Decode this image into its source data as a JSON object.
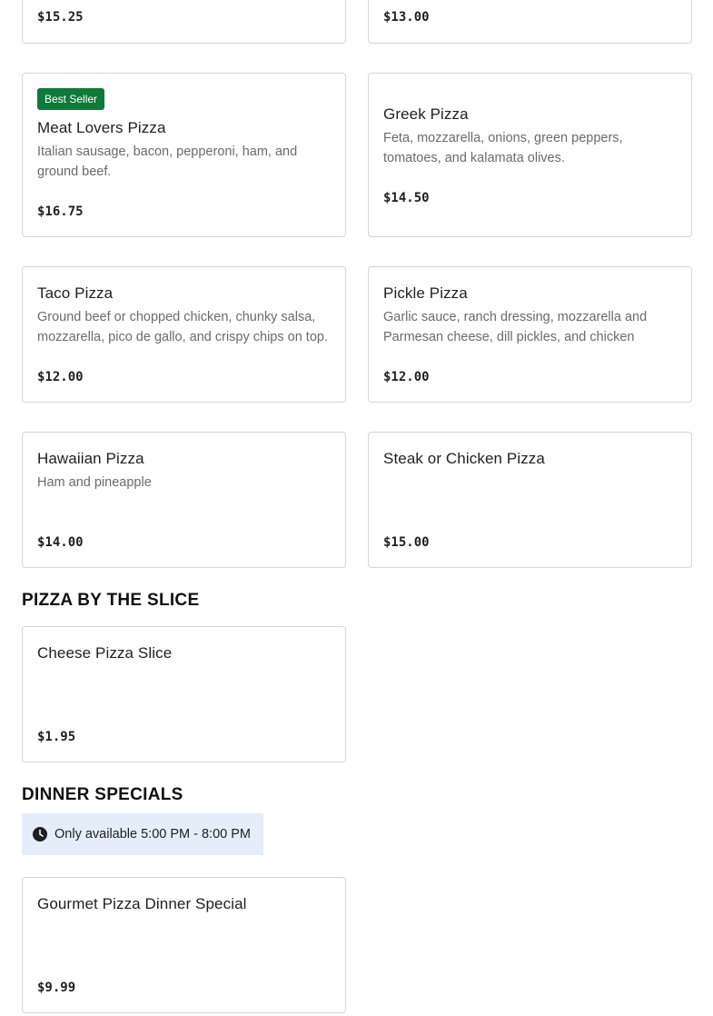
{
  "top_cards": [
    {
      "price": "$15.25"
    },
    {
      "price": "$13.00"
    }
  ],
  "pizzas": [
    {
      "badge": "Best Seller",
      "name": "Meat Lovers Pizza",
      "description": "Italian sausage, bacon, pepperoni, ham, and ground beef.",
      "price": "$16.75"
    },
    {
      "name": "Greek Pizza",
      "description": "Feta, mozzarella, onions, green peppers, tomatoes, and kalamata olives.",
      "price": "$14.50"
    },
    {
      "name": "Taco Pizza",
      "description": "Ground beef or chopped chicken, chunky salsa, mozzarella, pico de gallo, and crispy chips on top.",
      "price": "$12.00"
    },
    {
      "name": "Pickle Pizza",
      "description": "Garlic sauce, ranch dressing, mozzarella and Parmesan cheese, dill pickles, and chicken",
      "price": "$12.00"
    },
    {
      "name": "Hawaiian Pizza",
      "description": "Ham and pineapple",
      "price": "$14.00"
    },
    {
      "name": "Steak or Chicken Pizza",
      "price": "$15.00"
    }
  ],
  "slice_section": {
    "title": "PIZZA BY THE SLICE",
    "items": [
      {
        "name": "Cheese Pizza Slice",
        "price": "$1.95"
      }
    ]
  },
  "dinner_section": {
    "title": "DINNER SPECIALS",
    "notice_icon": "clock-icon",
    "notice": "Only available 5:00 PM - 8:00 PM",
    "items": [
      {
        "name": "Gourmet Pizza Dinner Special",
        "price": "$9.99"
      }
    ]
  },
  "colors": {
    "badge": "#0e7a3a",
    "notice_bg": "#e4edf9",
    "card_border": "#d6d6d6",
    "description": "#6b6b6b"
  }
}
